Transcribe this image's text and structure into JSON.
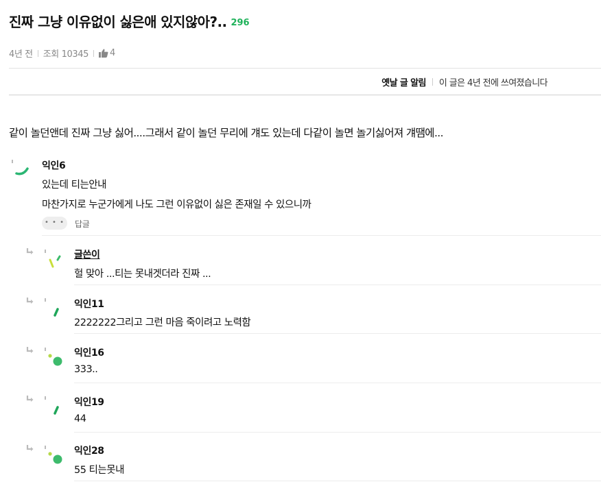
{
  "post": {
    "title": "진짜 그냥 이유없이 싫은애 있지않아?..",
    "comment_count": "296",
    "age": "4년 전",
    "views": "조회 10345",
    "likes": "4",
    "body": "같이 놀던앤데 진짜 그냥 싫어....그래서 같이 놀던 무리에 걔도 있는데 다같이 놀면 놀기싫어져 걔땜에..."
  },
  "old_notice": {
    "label": "옛날 글 알림",
    "text": "이 글은 4년 전에 쓰여졌습니다"
  },
  "comments": [
    {
      "nick": "익인6",
      "lines": [
        "있는데 티는안내",
        "마찬가지로 누군가에게 나도 그런 이유없이 싫은 존재일 수 있으니까"
      ],
      "more_label": "• • •",
      "reply_label": "답글"
    }
  ],
  "replies": [
    {
      "nick": "글쓴이",
      "text": "헐 맞아 ...티는 못내겟더라 진짜 ..."
    },
    {
      "nick": "익인11",
      "text": "2222222그리고 그런 마음 죽이려고 노력함"
    },
    {
      "nick": "익인16",
      "text": "333.."
    },
    {
      "nick": "익인19",
      "text": "44"
    },
    {
      "nick": "익인28",
      "text": "55 티는못내"
    }
  ],
  "icons": {
    "thumb": "thumbs-up-icon",
    "reply": "reply-arrow-icon"
  },
  "colors": {
    "accent_green": "#1fb25a",
    "avatar_green": "#3dbb6c",
    "avatar_lime": "#b6d94a"
  }
}
